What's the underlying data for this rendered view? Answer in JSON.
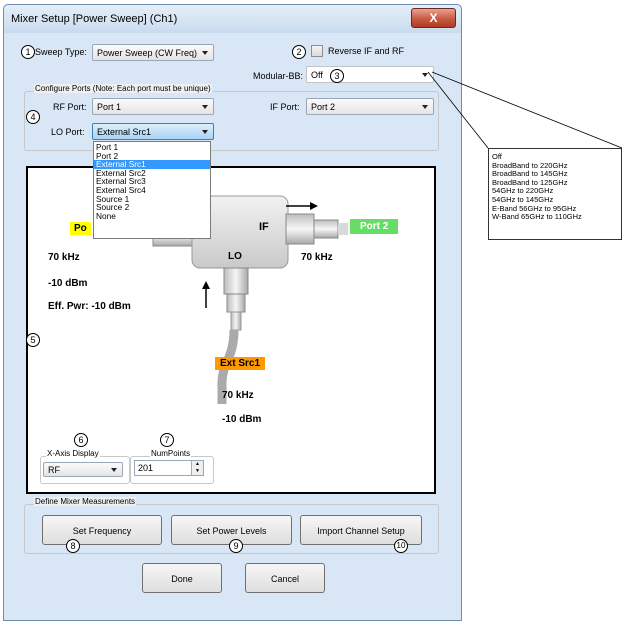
{
  "window": {
    "title": "Mixer Setup [Power Sweep] (Ch1)",
    "close_glyph": "X"
  },
  "callouts": [
    "1",
    "2",
    "3",
    "4",
    "5",
    "6",
    "7",
    "8",
    "9",
    "10"
  ],
  "sweep": {
    "label": "Sweep Type:",
    "value": "Power Sweep (CW Freq)"
  },
  "reverse": {
    "label": "Reverse IF and RF",
    "checked": false
  },
  "modular_bb": {
    "label": "Modular-BB:",
    "value": "Off",
    "options": [
      "Off",
      "BroadBand to 220GHz",
      "BroadBand to 145GHz",
      "BroadBand to 125GHz",
      "54GHz to 220GHz",
      "54GHz to 145GHz",
      "E-Band 56GHz to 95GHz",
      "W-Band 65GHz to 110GHz"
    ]
  },
  "ports": {
    "group_label": "Configure Ports (Note: Each port must be unique)",
    "rf_label": "RF Port:",
    "rf_value": "Port 1",
    "if_label": "IF Port:",
    "if_value": "Port 2",
    "lo_label": "LO Port:",
    "lo_value": "External Src1",
    "lo_options": [
      "Port 1",
      "Port 2",
      "External Src1",
      "External Src2",
      "External Src3",
      "External Src4",
      "Source 1",
      "Source 2",
      "None"
    ],
    "lo_selected_index": 2
  },
  "diagram": {
    "rf_tag": "Po",
    "rf_freq": "70 kHz",
    "rf_power": "-10 dBm",
    "rf_eff": "Eff. Pwr: -10 dBm",
    "if_block": "IF",
    "lo_block": "LO",
    "if_port": "Port 2",
    "if_freq": "70 kHz",
    "lo_tag": "Ext Src1",
    "lo_freq": "70 kHz",
    "lo_power": "-10 dBm",
    "colors": {
      "rf_tag": "#ffff00",
      "if_tag": "#66dd66",
      "lo_tag": "#ff9900"
    }
  },
  "xaxis": {
    "label": "X-Axis Display",
    "value": "RF"
  },
  "numpoints": {
    "label": "NumPoints",
    "value": "201"
  },
  "measure": {
    "group_label": "Define Mixer Measurements",
    "set_freq": "Set Frequency",
    "set_power": "Set Power Levels",
    "import": "Import Channel Setup"
  },
  "footer": {
    "done": "Done",
    "cancel": "Cancel"
  }
}
